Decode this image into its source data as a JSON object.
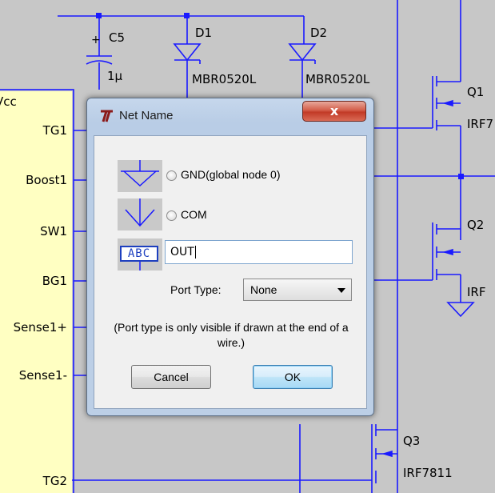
{
  "schematic": {
    "capacitor_name": "C5",
    "capacitor_value": "1µ",
    "capacitor_plus": "+",
    "diode1_name": "D1",
    "diode1_part": "MBR0520L",
    "diode2_name": "D2",
    "diode2_part": "MBR0520L",
    "q1_name": "Q1",
    "q1_part": "IRF7",
    "q2_name": "Q2",
    "q2_part": "IRF",
    "q3_name": "Q3",
    "q3_part": "IRF7811",
    "ic_label": "Vcc",
    "pins": [
      "TG1",
      "Boost1",
      "SW1",
      "BG1",
      "Sense1+",
      "Sense1-",
      "TG2"
    ]
  },
  "dialog": {
    "title": "Net Name",
    "close_label": "x",
    "options": {
      "gnd_label": "GND(global node 0)",
      "com_label": "COM",
      "abc_label": "ABC"
    },
    "net_name_value": "OUT",
    "port_type_label": "Port Type:",
    "port_type_value": "None",
    "note": "(Port type is only visible if drawn at the end of a wire.)",
    "cancel_label": "Cancel",
    "ok_label": "OK"
  }
}
